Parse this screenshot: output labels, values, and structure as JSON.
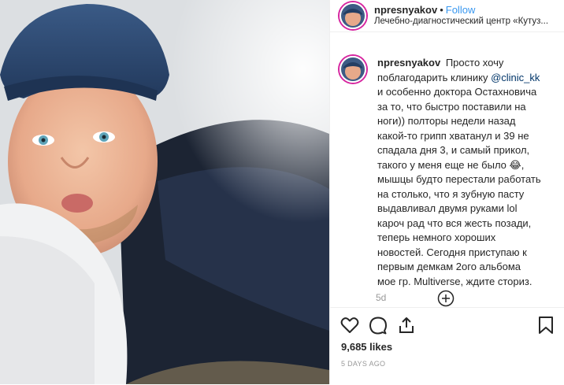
{
  "post": {
    "username": "npresnyakov",
    "separator": "•",
    "follow_label": "Follow",
    "location": "Лечебно-диагностический центр «Кутуз...",
    "caption_lines": [
      "Просто хочу",
      "поблагодарить клинику @clinic_kk",
      "и особенно доктора Остахновича",
      "за то, что быстро поставили на",
      "ноги)) полторы недели назад",
      "какой-то грипп хватанул и 39 не",
      "спадала дня 3, и самый прикол,",
      "такого у меня еще не было 😂,",
      "мышцы будто перестали работать",
      "на столько, что я зубную пасту",
      "выдавливал двумя руками lol",
      "кароч рад что вся жесть позади,",
      "теперь немного хороших",
      "новостей. Сегодня приступаю к",
      "первым демкам 2ого альбома",
      "мое гр. Multiverse, ждите сториз."
    ],
    "caption_first": "Просто хочу",
    "mention": "@clinic_kk",
    "comment_age": "5d",
    "likes": "9,685 likes",
    "date": "5 DAYS AGO"
  },
  "icons": {
    "like": "heart-icon",
    "comment": "comment-icon",
    "share": "share-icon",
    "save": "bookmark-icon",
    "more_comments": "plus-circle-icon"
  },
  "colors": {
    "follow": "#3897f0",
    "mention": "#003569",
    "muted": "#999999"
  }
}
